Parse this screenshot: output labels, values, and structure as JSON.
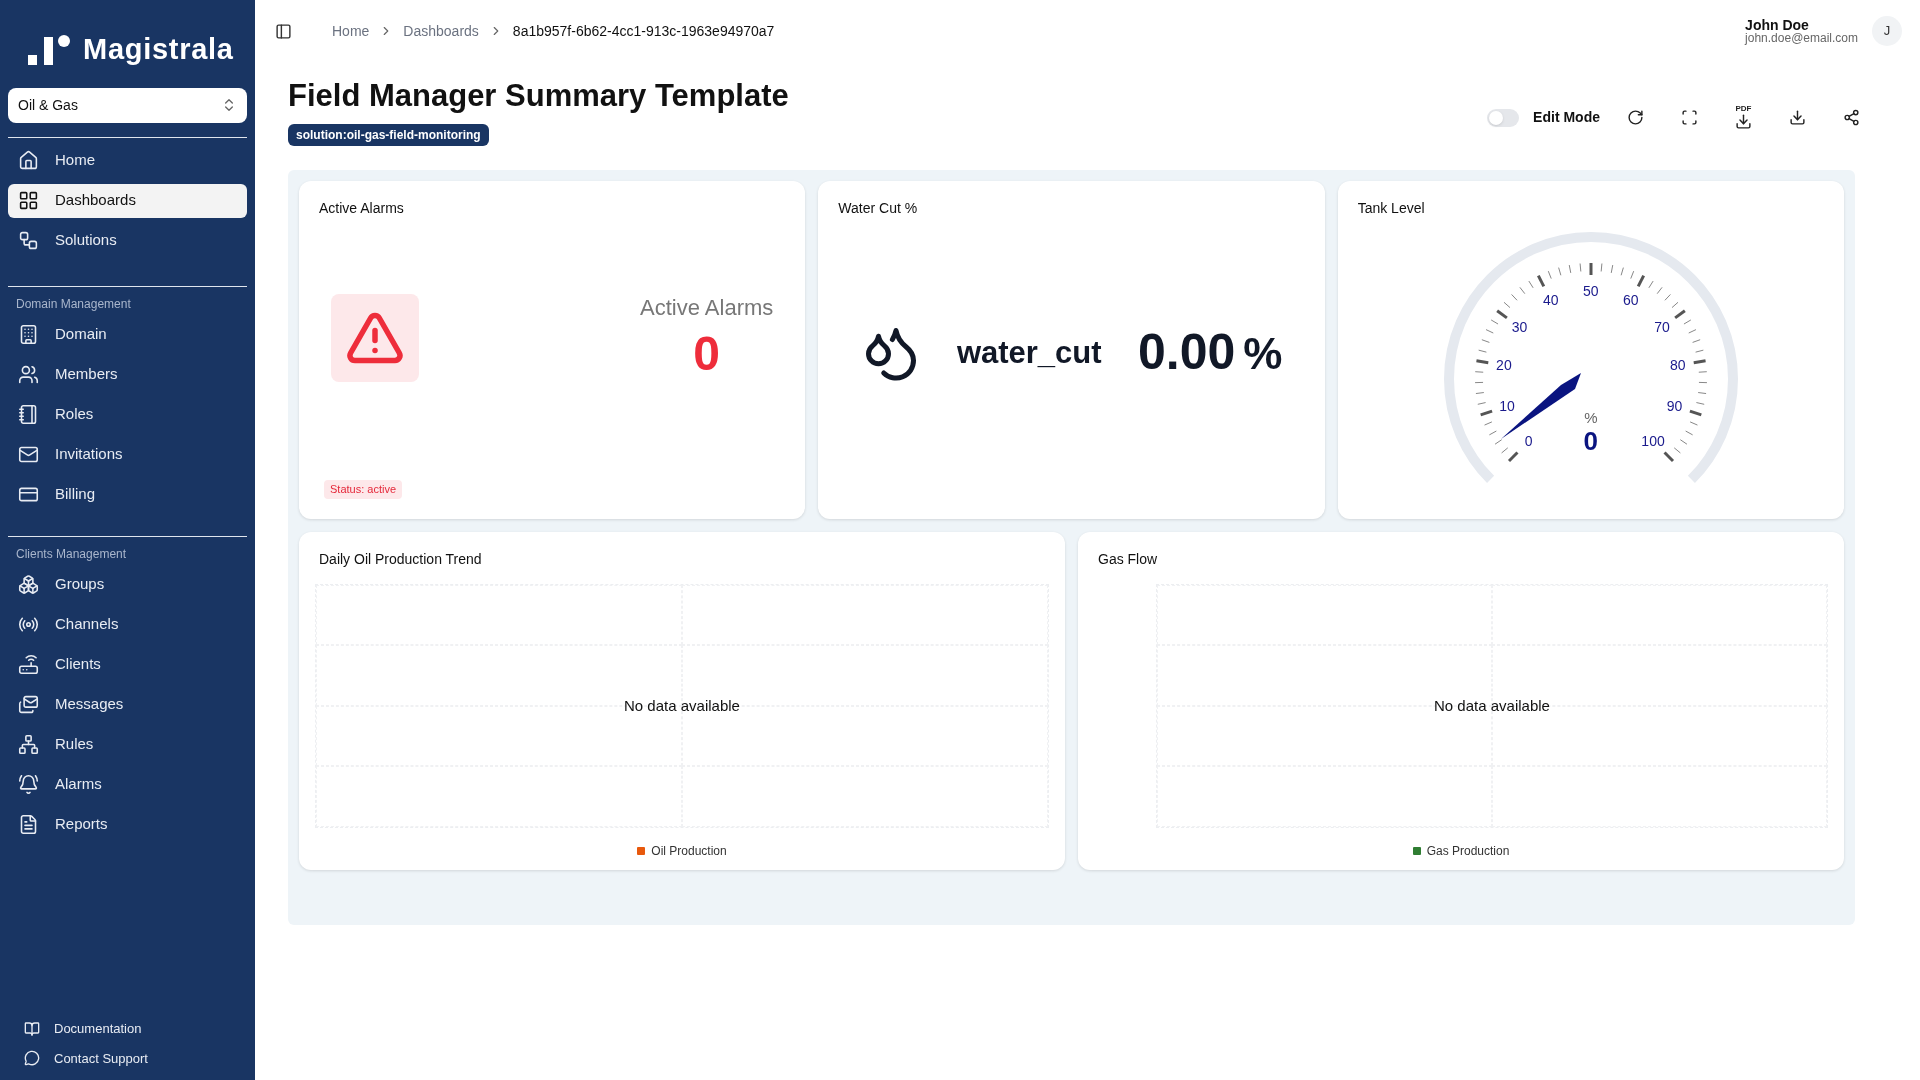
{
  "brand": {
    "name": "Magistrala"
  },
  "domain_select": {
    "value": "Oil & Gas"
  },
  "sidebar": {
    "main_items": [
      {
        "label": "Home",
        "selected": false
      },
      {
        "label": "Dashboards",
        "selected": true
      },
      {
        "label": "Solutions",
        "selected": false
      }
    ],
    "sections": [
      {
        "title": "Domain Management",
        "items": [
          {
            "label": "Domain",
            "selected": false
          },
          {
            "label": "Members",
            "selected": false
          },
          {
            "label": "Roles",
            "selected": false
          },
          {
            "label": "Invitations",
            "selected": false
          },
          {
            "label": "Billing",
            "selected": false
          }
        ]
      },
      {
        "title": "Clients Management",
        "items": [
          {
            "label": "Groups",
            "selected": false
          },
          {
            "label": "Channels",
            "selected": false
          },
          {
            "label": "Clients",
            "selected": false
          },
          {
            "label": "Messages",
            "selected": false
          },
          {
            "label": "Rules",
            "selected": false
          },
          {
            "label": "Alarms",
            "selected": false
          },
          {
            "label": "Reports",
            "selected": false
          }
        ]
      }
    ],
    "footer_links": [
      "Documentation",
      "Contact Support"
    ]
  },
  "breadcrumb": [
    "Home",
    "Dashboards",
    "8a1b957f-6b62-4cc1-913c-1963e94970a7"
  ],
  "user": {
    "name": "John Doe",
    "email": "john.doe@email.com",
    "initial": "J"
  },
  "page": {
    "title": "Field Manager Summary Template",
    "tag": "solution:oil-gas-field-monitoring"
  },
  "toolbar": {
    "edit_mode": {
      "label": "Edit Mode",
      "on": false
    },
    "pdf_label": "PDF"
  },
  "widgets": [
    {
      "kind": "alarm",
      "title": "Active Alarms",
      "label": "Active Alarms",
      "value": "0",
      "status": "Status: active"
    },
    {
      "kind": "value",
      "title": "Water Cut %",
      "label": "water_cut",
      "value": "0.00",
      "unit": "%"
    },
    {
      "kind": "gauge",
      "title": "Tank Level",
      "unit": "%",
      "value": "0",
      "scale": [
        "0",
        "10",
        "20",
        "30",
        "40",
        "50",
        "60",
        "70",
        "80",
        "90",
        "100"
      ]
    }
  ],
  "charts": [
    {
      "title": "Daily Oil Production Trend",
      "message": "No data available",
      "legend": {
        "label": "Oil Production",
        "color": "#e8590c"
      }
    },
    {
      "title": "Gas Flow",
      "message": "No data available",
      "legend": {
        "label": "Gas Production",
        "color": "#2f7d32"
      }
    }
  ]
}
